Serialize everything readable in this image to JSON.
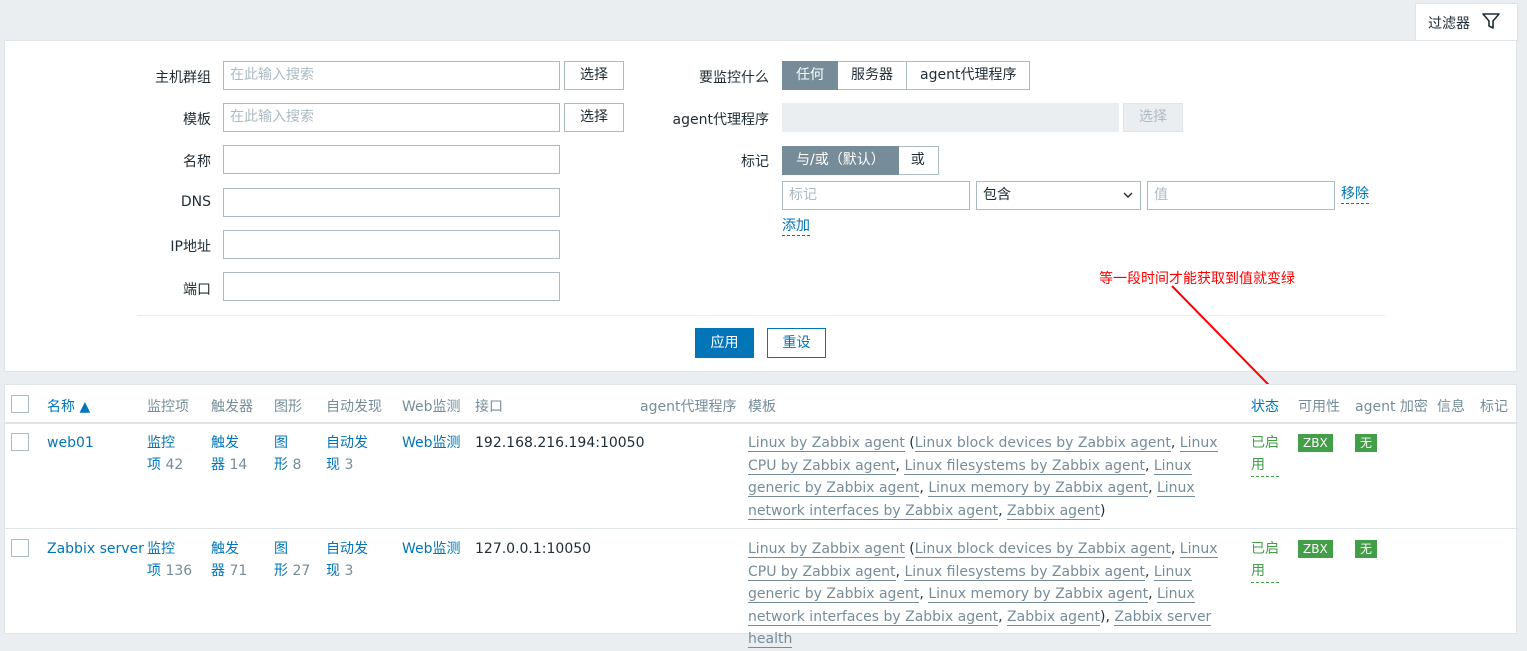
{
  "filter_tab": {
    "label": "过滤器",
    "icon": "funnel-icon"
  },
  "filter": {
    "host_group": {
      "label": "主机群组",
      "placeholder": "在此输入搜索",
      "select_label": "选择"
    },
    "template": {
      "label": "模板",
      "placeholder": "在此输入搜索",
      "select_label": "选择"
    },
    "name": {
      "label": "名称",
      "value": ""
    },
    "dns": {
      "label": "DNS",
      "value": ""
    },
    "ip": {
      "label": "IP地址",
      "value": ""
    },
    "port": {
      "label": "端口",
      "value": ""
    },
    "monitored_by": {
      "label": "要监控什么",
      "options": [
        "任何",
        "服务器",
        "agent代理程序"
      ],
      "selected": "任何"
    },
    "proxy": {
      "label": "agent代理程序",
      "select_label": "选择"
    },
    "tags": {
      "label": "标记",
      "options": [
        "与/或（默认）",
        "或"
      ],
      "selected": "与/或（默认）",
      "tag_placeholder": "标记",
      "operator": "包含",
      "value_placeholder": "值",
      "remove_label": "移除",
      "add_label": "添加"
    },
    "apply_label": "应用",
    "reset_label": "重设"
  },
  "annotation": "等一段时间才能获取到值就变绿",
  "table": {
    "headers": {
      "name": "名称 ▲",
      "items": "监控项",
      "triggers": "触发器",
      "graphs": "图形",
      "discovery": "自动发现",
      "web": "Web监测",
      "interface": "接口",
      "proxy": "agent代理程序",
      "templates": "模板",
      "status": "状态",
      "availability": "可用性",
      "encryption": "agent 加密",
      "info": "信息",
      "tags": "标记"
    },
    "rows": [
      {
        "name": "web01",
        "items_l1": "监控",
        "items_l2": "项",
        "items_count": "42",
        "triggers_l1": "触发",
        "triggers_l2": "器",
        "triggers_count": "14",
        "graphs_l1": "图",
        "graphs_l2": "形",
        "graphs_count": "8",
        "discovery_l1": "自动发",
        "discovery_l2": "现",
        "discovery_count": "3",
        "web": "Web监测",
        "interface": "192.168.216.194:10050",
        "template_main": "Linux by Zabbix agent",
        "template_children": [
          "Linux block devices by Zabbix agent",
          "Linux CPU by Zabbix agent",
          "Linux filesystems by Zabbix agent",
          "Linux generic by Zabbix agent",
          "Linux memory by Zabbix agent",
          "Linux network interfaces by Zabbix agent",
          "Zabbix agent"
        ],
        "template_extra": "",
        "status_l1": "已启",
        "status_l2": "用",
        "availability": "ZBX",
        "encryption": "无"
      },
      {
        "name": "Zabbix server",
        "items_l1": "监控",
        "items_l2": "项",
        "items_count": "136",
        "triggers_l1": "触发",
        "triggers_l2": "器",
        "triggers_count": "71",
        "graphs_l1": "图",
        "graphs_l2": "形",
        "graphs_count": "27",
        "discovery_l1": "自动发",
        "discovery_l2": "现",
        "discovery_count": "3",
        "web": "Web监测",
        "interface": "127.0.0.1:10050",
        "template_main": "Linux by Zabbix agent",
        "template_children": [
          "Linux block devices by Zabbix agent",
          "Linux CPU by Zabbix agent",
          "Linux filesystems by Zabbix agent",
          "Linux generic by Zabbix agent",
          "Linux memory by Zabbix agent",
          "Linux network interfaces by Zabbix agent",
          "Zabbix agent"
        ],
        "template_extra": "Zabbix server health",
        "status_l1": "已启",
        "status_l2": "用",
        "availability": "ZBX",
        "encryption": "无"
      }
    ]
  },
  "colors": {
    "primary": "#0275b8",
    "green": "#429e47",
    "annotation": "#ff0000",
    "muted": "#768d99"
  }
}
